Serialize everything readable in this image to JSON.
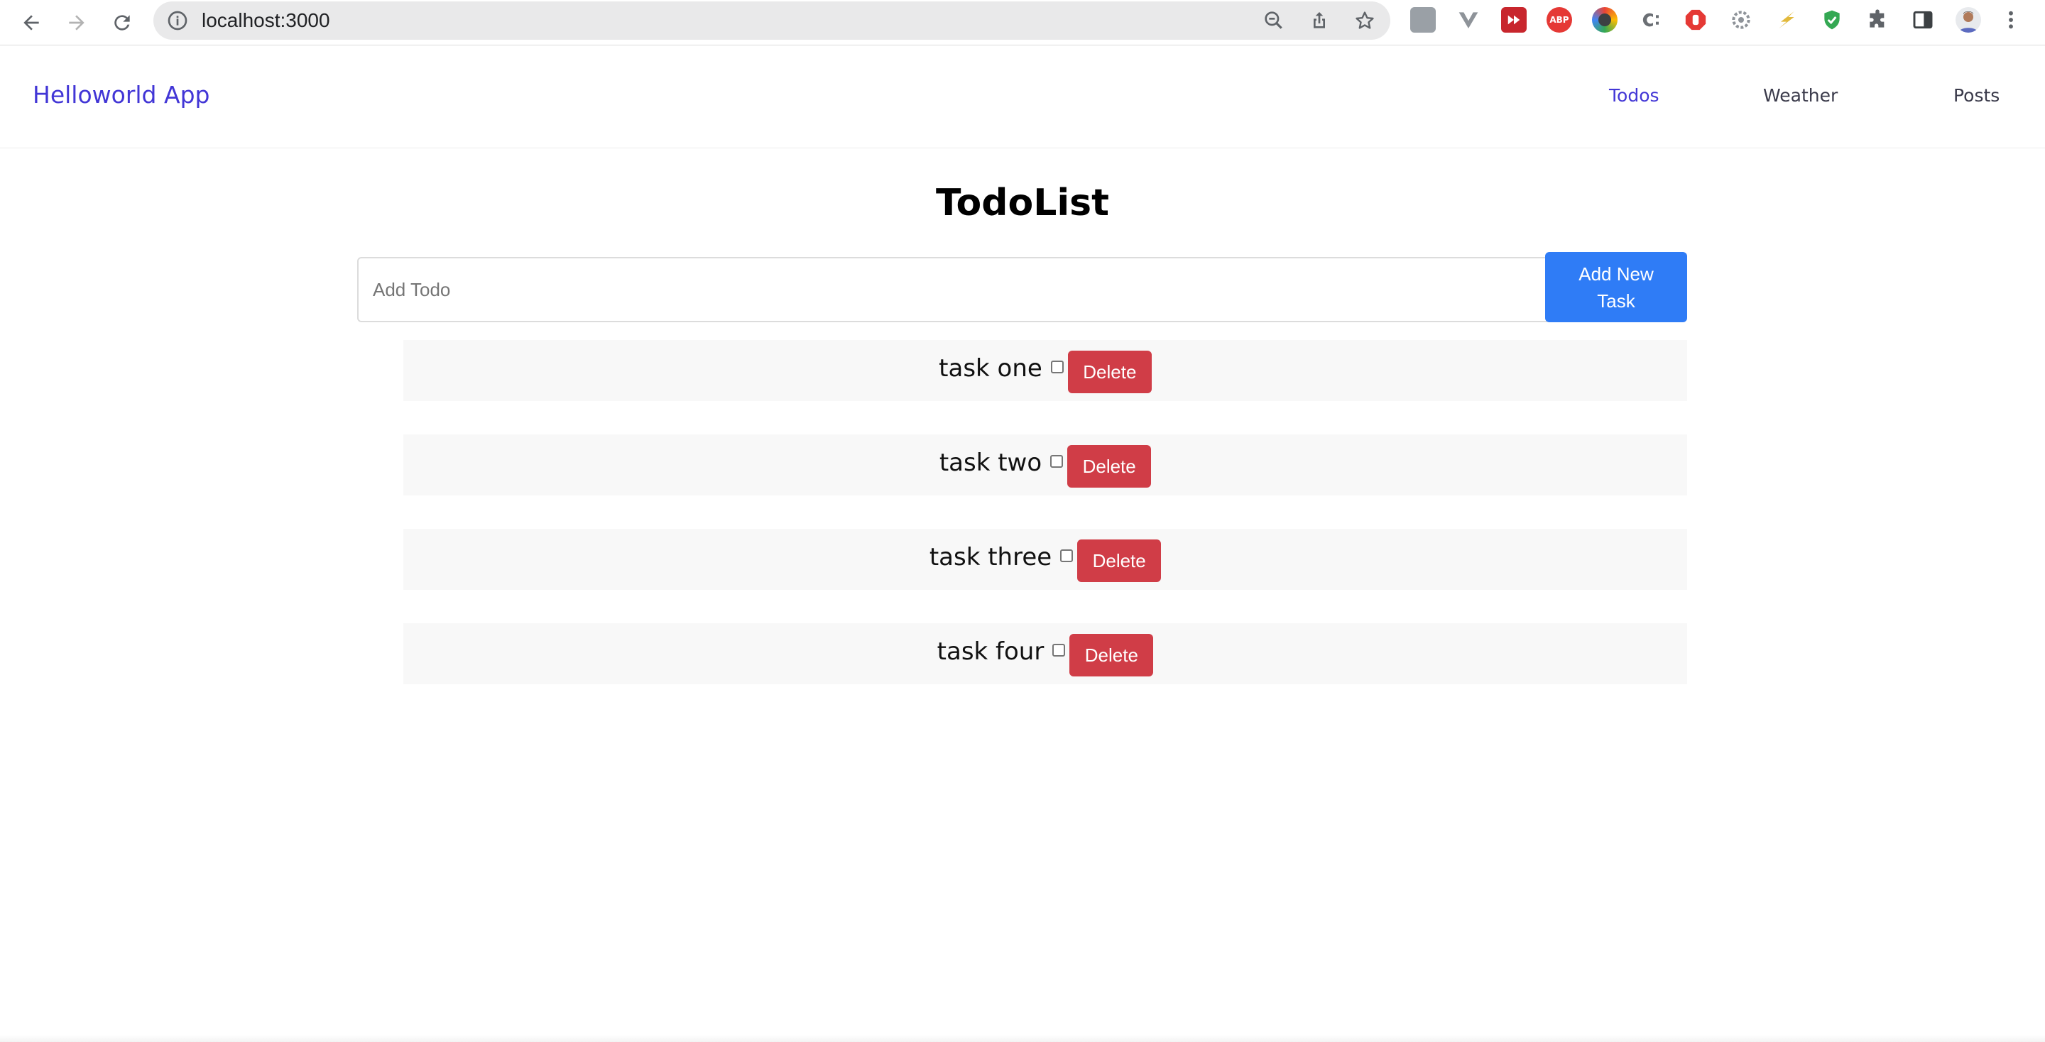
{
  "browser": {
    "url": "localhost:3000",
    "icons": {
      "back": "back-arrow-icon",
      "forward": "forward-arrow-icon",
      "reload": "reload-icon",
      "info": "info-icon",
      "zoom": "zoom-out-icon",
      "share": "share-icon",
      "bookmark": "star-icon",
      "extensions": "puzzle-icon",
      "sidepanel": "side-panel-icon",
      "menu": "kebab-menu-icon"
    },
    "extension_labels": {
      "abp": "ABP"
    }
  },
  "navbar": {
    "brand": "Helloworld App",
    "links": [
      {
        "label": "Todos",
        "active": true
      },
      {
        "label": "Weather",
        "active": false
      },
      {
        "label": "Posts",
        "active": false
      }
    ]
  },
  "main": {
    "title": "TodoList",
    "input": {
      "placeholder": "Add Todo",
      "value": ""
    },
    "add_button_label": "Add New Task",
    "todos": [
      {
        "text": "task one",
        "done": false,
        "delete_label": "Delete"
      },
      {
        "text": "task two",
        "done": false,
        "delete_label": "Delete"
      },
      {
        "text": "task three",
        "done": false,
        "delete_label": "Delete"
      },
      {
        "text": "task four",
        "done": false,
        "delete_label": "Delete"
      }
    ]
  },
  "colors": {
    "brand": "#4236d6",
    "primary_button": "#2f7cf6",
    "danger_button": "#d03d47",
    "row_background": "#f8f8f8"
  }
}
